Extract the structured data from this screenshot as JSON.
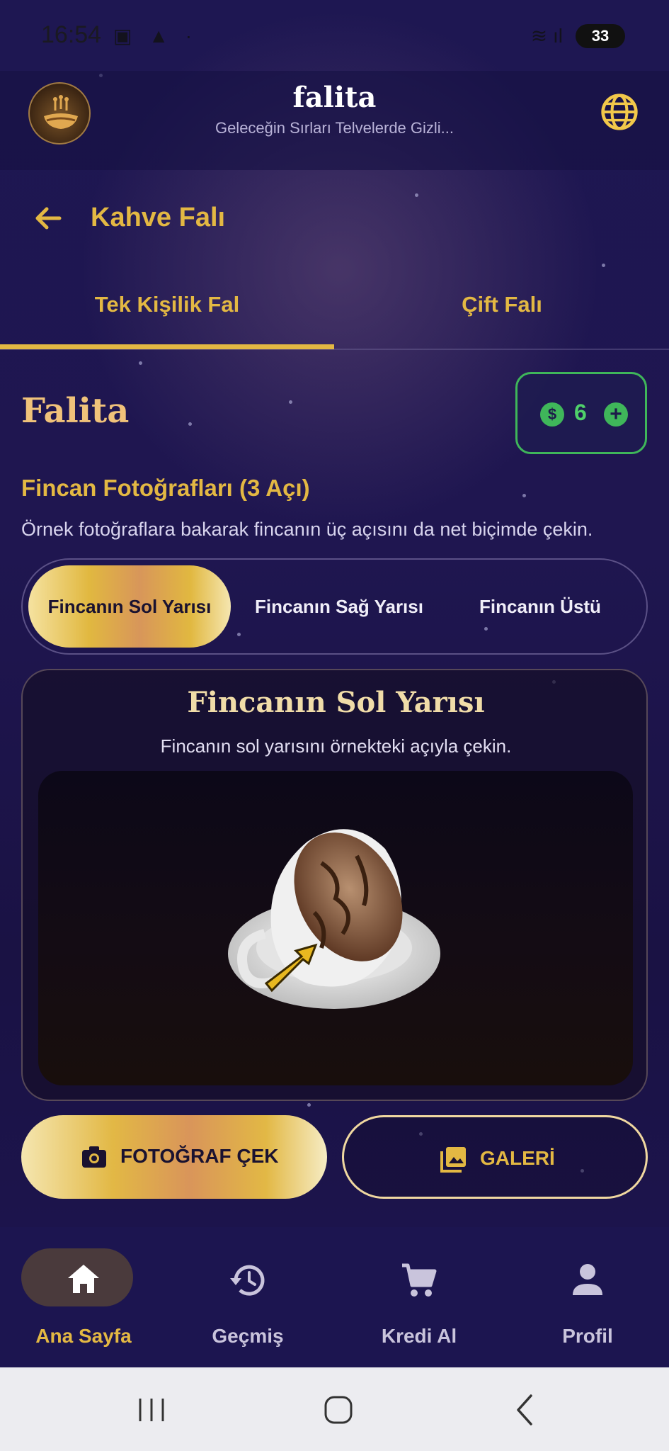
{
  "status_bar": {
    "time": "16:54",
    "battery": "33"
  },
  "header": {
    "title": "falita",
    "subtitle": "Geleceğin Sırları Telvelerde Gizli..."
  },
  "topbar": {
    "title": "Kahve Falı"
  },
  "tabs": [
    {
      "label": "Tek Kişilik Fal",
      "active": true
    },
    {
      "label": "Çift Falı",
      "active": false
    }
  ],
  "section": {
    "brand": "Falita",
    "credits": {
      "count": "6",
      "coin_symbol": "$",
      "plus": "+"
    },
    "title": "Fincan Fotoğrafları (3 Açı)",
    "description": "Örnek fotoğraflara bakarak fincanın üç açısını da net biçimde çekin."
  },
  "segments": [
    {
      "label": "Fincanın Sol Yarısı",
      "active": true
    },
    {
      "label": "Fincanın Sağ Yarısı",
      "active": false
    },
    {
      "label": "Fincanın Üstü",
      "active": false
    }
  ],
  "card": {
    "title": "Fincanın Sol Yarısı",
    "description": "Fincanın sol yarısını örnekteki açıyla çekin."
  },
  "buttons": {
    "camera": "FOTOĞRAF ÇEK",
    "gallery": "GALERİ"
  },
  "bottom_nav": [
    {
      "label": "Ana Sayfa",
      "icon": "home-icon",
      "active": true
    },
    {
      "label": "Geçmiş",
      "icon": "history-icon",
      "active": false
    },
    {
      "label": "Kredi Al",
      "icon": "cart-icon",
      "active": false
    },
    {
      "label": "Profil",
      "icon": "person-icon",
      "active": false
    }
  ],
  "colors": {
    "accent_gold": "#e3b843",
    "credit_green": "#3fb65a",
    "background": "#1c1550"
  }
}
